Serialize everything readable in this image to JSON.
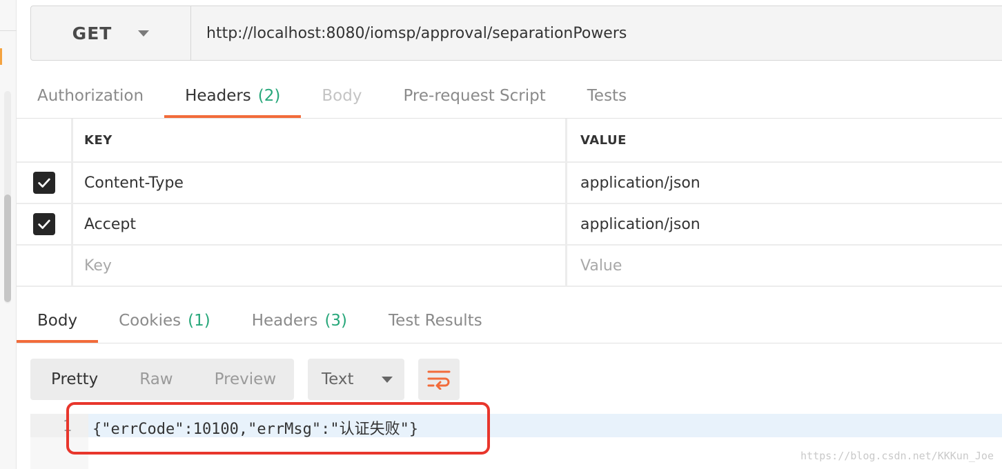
{
  "request": {
    "method": "GET",
    "url": "http://localhost:8080/iomsp/approval/separationPowers"
  },
  "request_tabs": [
    {
      "label": "Authorization",
      "count": "",
      "state": "normal"
    },
    {
      "label": "Headers",
      "count": "(2)",
      "state": "active"
    },
    {
      "label": "Body",
      "count": "",
      "state": "disabled"
    },
    {
      "label": "Pre-request Script",
      "count": "",
      "state": "normal"
    },
    {
      "label": "Tests",
      "count": "",
      "state": "normal"
    }
  ],
  "headers_table": {
    "columns": {
      "key": "KEY",
      "value": "VALUE"
    },
    "rows": [
      {
        "checked": true,
        "key": "Content-Type",
        "value": "application/json"
      },
      {
        "checked": true,
        "key": "Accept",
        "value": "application/json"
      }
    ],
    "new_row": {
      "key_placeholder": "Key",
      "value_placeholder": "Value"
    }
  },
  "response_tabs": [
    {
      "label": "Body",
      "count": "",
      "state": "active"
    },
    {
      "label": "Cookies",
      "count": "(1)",
      "state": "normal"
    },
    {
      "label": "Headers",
      "count": "(3)",
      "state": "normal"
    },
    {
      "label": "Test Results",
      "count": "",
      "state": "normal"
    }
  ],
  "response_toolbar": {
    "view_modes": [
      "Pretty",
      "Raw",
      "Preview"
    ],
    "active_view": "Pretty",
    "format": "Text",
    "wrap_icon": "wrap-lines-icon"
  },
  "response_body": {
    "line_number": "1",
    "code": "{\"errCode\":10100,\"errMsg\":\"认证失败\"}"
  },
  "watermark": "https://blog.csdn.net/KKKun_Joe",
  "colors": {
    "accent": "#f26b3a",
    "count_green": "#27a77a",
    "annotation_red": "#e8362c"
  }
}
